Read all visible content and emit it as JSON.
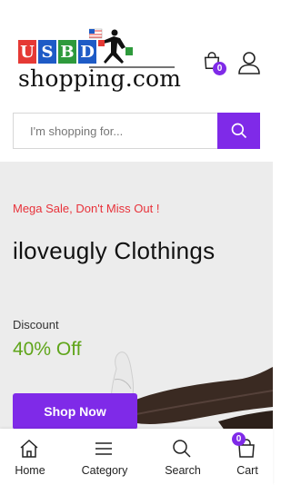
{
  "header": {
    "logo": {
      "tiles": [
        {
          "letter": "U",
          "color": "#e53935"
        },
        {
          "letter": "S",
          "color": "#1e5bc6"
        },
        {
          "letter": "B",
          "color": "#2e9a3c"
        },
        {
          "letter": "D",
          "color": "#1e5bc6"
        }
      ],
      "wordmark": "shopping.com"
    },
    "cart_count": "0",
    "icons": {
      "cart": "shopping-bag-icon",
      "account": "user-icon"
    }
  },
  "search": {
    "placeholder": "I'm shopping for...",
    "value": "",
    "button_icon": "search-icon",
    "accent": "#7f2ae8"
  },
  "hero": {
    "sale_text": "Mega Sale, Don't Miss Out !",
    "title": "iloveugly Clothings",
    "discount_label": "Discount",
    "discount_value": "40% Off",
    "cta_label": "Shop Now",
    "colors": {
      "sale": "#e8323a",
      "discount": "#5fa51a",
      "background": "#ececec"
    }
  },
  "bottom_nav": {
    "items": [
      {
        "label": "Home",
        "icon": "home-icon"
      },
      {
        "label": "Category",
        "icon": "menu-icon"
      },
      {
        "label": "Search",
        "icon": "search-icon"
      },
      {
        "label": "Cart",
        "icon": "cart-icon",
        "badge": "0"
      }
    ]
  }
}
